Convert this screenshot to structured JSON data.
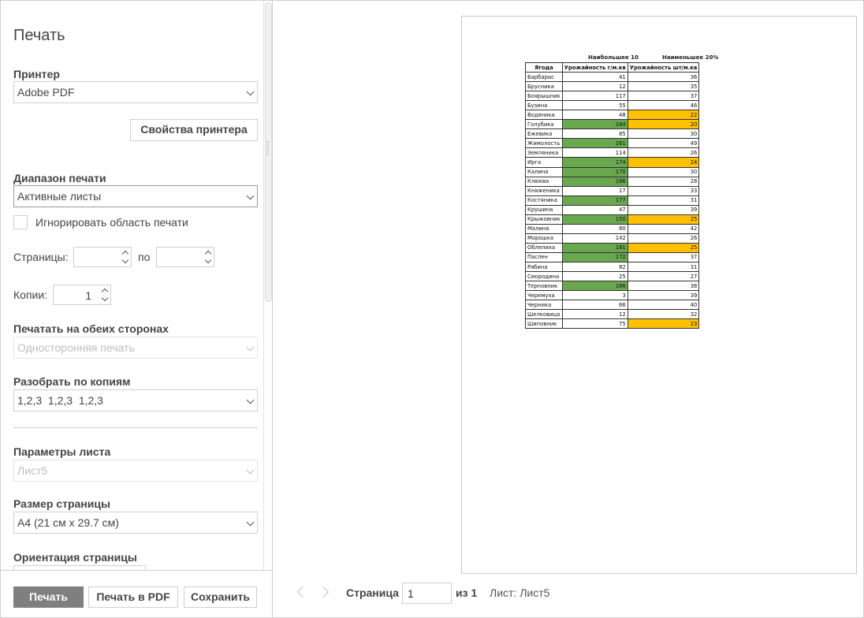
{
  "left": {
    "title": "Печать",
    "printer": {
      "label": "Принтер",
      "value": "Adobe PDF",
      "properties_button": "Свойства принтера"
    },
    "range": {
      "label": "Диапазон печати",
      "value": "Активные листы",
      "ignore_area_label": "Игнорировать область печати"
    },
    "pages": {
      "label": "Страницы:",
      "to_label": "по",
      "from_value": "",
      "to_value": ""
    },
    "copies": {
      "label": "Копии:",
      "value": "1"
    },
    "duplex": {
      "label": "Печатать на обеих сторонах",
      "value": "Односторонняя печать"
    },
    "collate": {
      "label": "Разобрать по копиям",
      "value": "1,2,3  1,2,3  1,2,3"
    },
    "sheet_params": {
      "label": "Параметры листа",
      "value": "Лист5"
    },
    "page_size": {
      "label": "Размер страницы",
      "value": "А4 (21 см x 29.7 см)"
    },
    "orientation": {
      "label": "Ориентация страницы"
    },
    "buttons": {
      "print": "Печать",
      "print_pdf": "Печать в PDF",
      "save": "Сохранить"
    }
  },
  "preview": {
    "page_label": "Страница",
    "page_value": "1",
    "of_label": "из 1",
    "sheet_label": "Лист: Лист5",
    "colors": {
      "green": "#6aa84f",
      "yellow": "#ffc000"
    },
    "sheet": {
      "header_top": [
        "Наибольшее 10",
        "Наименьшее 20%"
      ],
      "columns": [
        "Ягода",
        "Урожайность г/м.кв",
        "Урожайность шт/м.кв"
      ],
      "rows": [
        [
          "Барбарис",
          "41",
          "36",
          "",
          ""
        ],
        [
          "Брусника",
          "12",
          "35",
          "",
          ""
        ],
        [
          "Боярышник",
          "117",
          "37",
          "",
          ""
        ],
        [
          "Бузина",
          "55",
          "46",
          "",
          ""
        ],
        [
          "Водяника",
          "48",
          "22",
          "",
          "y"
        ],
        [
          "Голубика",
          "184",
          "20",
          "g",
          "y"
        ],
        [
          "Ежевика",
          "85",
          "30",
          "",
          ""
        ],
        [
          "Жимолость",
          "161",
          "49",
          "g",
          ""
        ],
        [
          "Земляника",
          "114",
          "26",
          "",
          ""
        ],
        [
          "Ирга",
          "174",
          "24",
          "g",
          "y"
        ],
        [
          "Калина",
          "170",
          "30",
          "g",
          ""
        ],
        [
          "Клюква",
          "186",
          "28",
          "g",
          ""
        ],
        [
          "Княженика",
          "17",
          "33",
          "",
          ""
        ],
        [
          "Костяника",
          "177",
          "31",
          "g",
          ""
        ],
        [
          "Крушина",
          "47",
          "39",
          "",
          ""
        ],
        [
          "Крыжовник",
          "150",
          "25",
          "g",
          "y"
        ],
        [
          "Малина",
          "80",
          "42",
          "",
          ""
        ],
        [
          "Морошка",
          "142",
          "26",
          "",
          ""
        ],
        [
          "Облепиха",
          "181",
          "25",
          "g",
          "y"
        ],
        [
          "Паслен",
          "172",
          "37",
          "g",
          ""
        ],
        [
          "Рябина",
          "82",
          "31",
          "",
          ""
        ],
        [
          "Смородина",
          "25",
          "27",
          "",
          ""
        ],
        [
          "Терновник",
          "166",
          "38",
          "g",
          ""
        ],
        [
          "Черемуха",
          "3",
          "39",
          "",
          ""
        ],
        [
          "Черника",
          "66",
          "40",
          "",
          ""
        ],
        [
          "Шелковица",
          "12",
          "32",
          "",
          ""
        ],
        [
          "Шиповник",
          "75",
          "23",
          "",
          "y"
        ]
      ]
    }
  }
}
